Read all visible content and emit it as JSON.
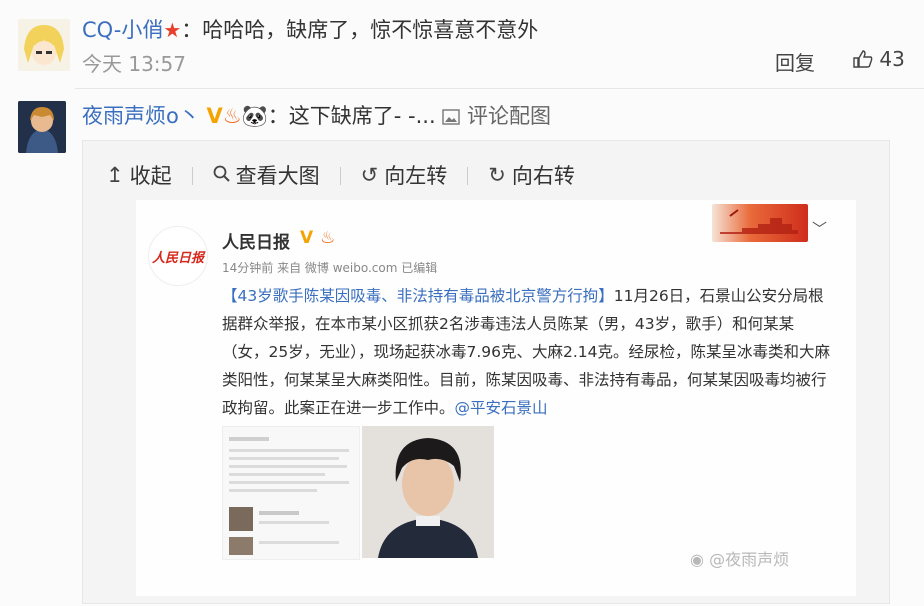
{
  "comment1": {
    "username": "CQ-小俏",
    "text": "：哈哈哈，缺席了，惊不惊喜意不意外",
    "time": "今天 13:57",
    "reply_label": "回复",
    "likes": "43"
  },
  "comment2": {
    "username": "夜雨声烦o丶",
    "text": "：这下缺席了- -...",
    "image_link": "评论配图"
  },
  "viewer": {
    "collapse": "收起",
    "view_large": "查看大图",
    "rotate_left": "向左转",
    "rotate_right": "向右转"
  },
  "post": {
    "author": "人民日报",
    "logo_text": "人民日报",
    "meta": "14分钟前 来自 微博 weibo.com  已编辑",
    "headline": "【43岁歌手陈某因吸毒、非法持有毒品被北京警方行拘】",
    "body": "11月26日，石景山公安分局根据群众举报，在本市某小区抓获2名涉毒违法人员陈某（男，43岁，歌手）和何某某（女，25岁，无业），现场起获冰毒7.96克、大麻2.14克。经尿检，陈某呈冰毒类和大麻类阳性，何某某呈大麻类阳性。目前，陈某因吸毒、非法持有毒品，何某某因吸毒均被行政拘留。此案正在进一步工作中。",
    "mention": "@平安石景山"
  },
  "watermark": "@夜雨声烦"
}
